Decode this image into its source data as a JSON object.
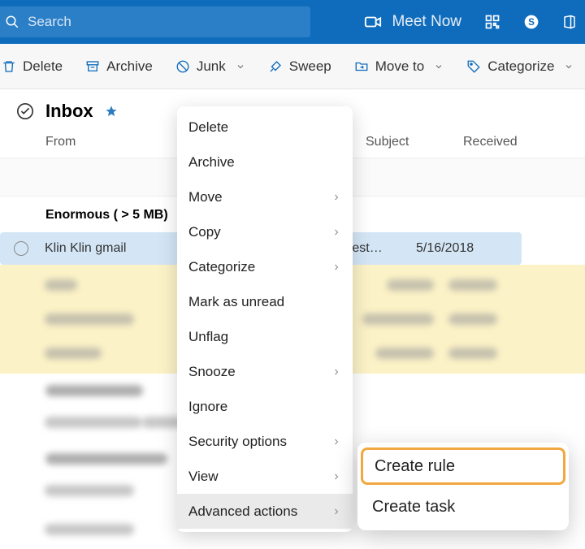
{
  "header": {
    "search_placeholder": "Search",
    "meet_now": "Meet Now"
  },
  "toolbar": {
    "delete": "Delete",
    "archive": "Archive",
    "junk": "Junk",
    "sweep": "Sweep",
    "move_to": "Move to",
    "categorize": "Categorize"
  },
  "folder": {
    "name": "Inbox"
  },
  "columns": {
    "from": "From",
    "subject": "Subject",
    "received": "Received"
  },
  "groups": {
    "enormous": "Enormous ( > 5 MB)"
  },
  "messages": {
    "selected": {
      "sender": "Klin Klin gmail",
      "subject": "ive test…",
      "received": "5/16/2018"
    }
  },
  "context_menu": {
    "delete": "Delete",
    "archive": "Archive",
    "move": "Move",
    "copy": "Copy",
    "categorize": "Categorize",
    "mark_unread": "Mark as unread",
    "unflag": "Unflag",
    "snooze": "Snooze",
    "ignore": "Ignore",
    "security_options": "Security options",
    "view": "View",
    "advanced_actions": "Advanced actions"
  },
  "submenu": {
    "create_rule": "Create rule",
    "create_task": "Create task"
  }
}
